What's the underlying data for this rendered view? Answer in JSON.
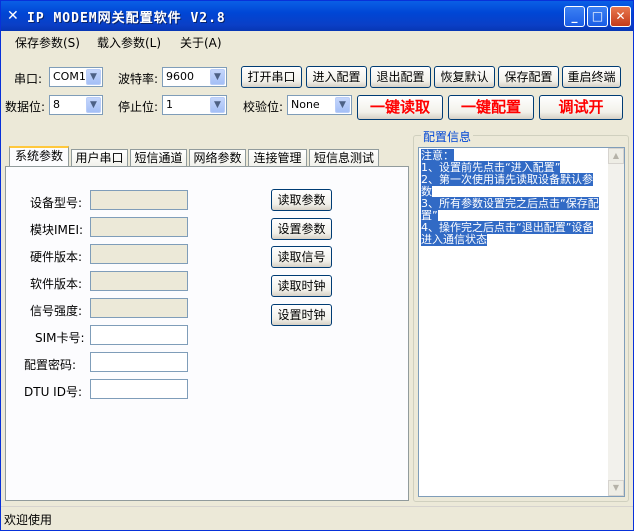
{
  "window": {
    "title": "IP MODEM网关配置软件 V2.8"
  },
  "menu": [
    "保存参数(S)",
    "载入参数(L)",
    "关于(A)"
  ],
  "serial": {
    "port_label": "串口:",
    "port_value": "COM11",
    "baud_label": "波特率:",
    "baud_value": "9600",
    "databits_label": "数据位:",
    "databits_value": "8",
    "stopbits_label": "停止位:",
    "stopbits_value": "1",
    "parity_label": "校验位:",
    "parity_value": "None"
  },
  "buttons": {
    "open_port": "打开串口",
    "enter_config": "进入配置",
    "exit_config": "退出配置",
    "restore_default": "恢复默认",
    "save_config": "保存配置",
    "restart": "重启终端",
    "one_key_read": "一键读取",
    "one_key_config": "一键配置",
    "debug_on": "调试开"
  },
  "tabs": [
    "系统参数",
    "用户串口",
    "短信通道",
    "网络参数",
    "连接管理",
    "短信息测试"
  ],
  "system_params": {
    "fields": [
      {
        "label": "设备型号:",
        "value": ""
      },
      {
        "label": "模块IMEI:",
        "value": ""
      },
      {
        "label": "硬件版本:",
        "value": ""
      },
      {
        "label": "软件版本:",
        "value": ""
      },
      {
        "label": "信号强度:",
        "value": ""
      },
      {
        "label": "SIM卡号:",
        "value": ""
      },
      {
        "label": "配置密码:",
        "value": ""
      },
      {
        "label": "DTU ID号:",
        "value": ""
      }
    ],
    "actions": [
      "读取参数",
      "设置参数",
      "读取信号",
      "读取时钟",
      "设置时钟"
    ]
  },
  "config_info": {
    "title": "配置信息",
    "lines": [
      "注意：",
      "1、设置前先点击“进入配置”",
      "2、第一次使用请先读取设备默认参数",
      "3、所有参数设置完之后点击“保存配置”",
      "4、操作完之后点击“退出配置”设备进入通信状态"
    ]
  },
  "status": {
    "text": "欢迎使用"
  },
  "colors": {
    "title_bar": "#0a4fd8",
    "accent_text": "#ff0000",
    "selection": "#316ac5"
  }
}
